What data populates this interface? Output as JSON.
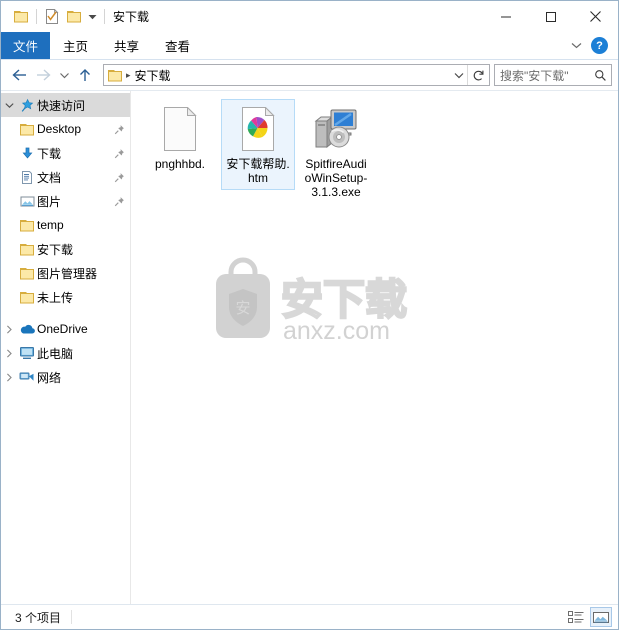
{
  "window": {
    "title": "安下载",
    "quick_access_toolbar": [
      {
        "name": "folder-icon",
        "tooltip": "安下载"
      },
      {
        "name": "properties-icon",
        "tooltip": "属性"
      },
      {
        "name": "new-folder-icon",
        "tooltip": "新建文件夹"
      },
      {
        "name": "chevron-down-icon",
        "tooltip": "自定义快速访问工具栏"
      }
    ],
    "controls": {
      "minimize": "—",
      "maximize": "□",
      "close": "✕"
    }
  },
  "ribbon": {
    "tabs": [
      {
        "label": "文件",
        "active": true
      },
      {
        "label": "主页",
        "active": false
      },
      {
        "label": "共享",
        "active": false
      },
      {
        "label": "查看",
        "active": false
      }
    ],
    "collapse_icon": "chevron-down-icon",
    "help_label": "?"
  },
  "navbar": {
    "back_tooltip": "后退",
    "forward_tooltip": "前进",
    "recent_tooltip": "最近浏览的位置",
    "up_tooltip": "上一级",
    "breadcrumb": [
      {
        "label": "安下载"
      }
    ],
    "dropdown_icon": "chevron-down-icon",
    "refresh_icon": "refresh-icon"
  },
  "search": {
    "placeholder": "搜索\"安下载\"",
    "icon": "search-icon"
  },
  "sidebar": {
    "groups": [
      {
        "label": "快速访问",
        "icon": "star-pin-icon",
        "expanded": true,
        "selected": true,
        "items": [
          {
            "label": "Desktop",
            "icon": "folder-icon",
            "pinned": true
          },
          {
            "label": "下载",
            "icon": "downloads-arrow-icon",
            "pinned": true
          },
          {
            "label": "文档",
            "icon": "documents-icon",
            "pinned": true
          },
          {
            "label": "图片",
            "icon": "pictures-icon",
            "pinned": true
          },
          {
            "label": "temp",
            "icon": "folder-icon",
            "pinned": false
          },
          {
            "label": "安下载",
            "icon": "folder-icon",
            "pinned": false
          },
          {
            "label": "图片管理器",
            "icon": "folder-icon",
            "pinned": false
          },
          {
            "label": "未上传",
            "icon": "folder-icon",
            "pinned": false
          }
        ]
      }
    ],
    "roots": [
      {
        "label": "OneDrive",
        "icon": "onedrive-cloud-icon",
        "expanded": false
      },
      {
        "label": "此电脑",
        "icon": "this-pc-monitor-icon",
        "expanded": false
      },
      {
        "label": "网络",
        "icon": "network-icon",
        "expanded": false
      }
    ]
  },
  "content": {
    "files": [
      {
        "name": "pnghhbd.",
        "icon": "blank-document-icon",
        "selected": false
      },
      {
        "name": "安下载帮助.htm",
        "icon": "html-pinwheel-icon",
        "selected": true
      },
      {
        "name": "SpitfireAudioWinSetup-3.1.3.exe",
        "icon": "installer-exe-icon",
        "selected": false
      }
    ],
    "watermark": {
      "outline_text": "安下载",
      "site_text": "anxz.com",
      "badge_char": "安",
      "color": "#d6d6d6"
    }
  },
  "statusbar": {
    "count_label": "3 个项目",
    "views": [
      {
        "name": "details-view-icon",
        "active": false
      },
      {
        "name": "large-icons-view-icon",
        "active": true
      }
    ]
  },
  "colors": {
    "accent": "#1e6fbe",
    "selection_fill": "#ebf4fd",
    "selection_border": "#b6dbf7",
    "window_border": "#9ab2c8",
    "folder_yellow": "#fce9a8",
    "watermark_grey": "#d6d6d6"
  }
}
